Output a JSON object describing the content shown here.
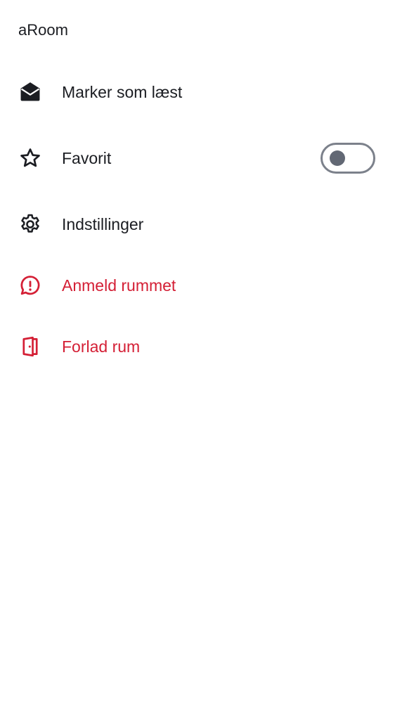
{
  "header": {
    "room_name": "aRoom"
  },
  "menu": {
    "items": [
      {
        "label": "Marker som læst",
        "icon": "mail-open-icon",
        "color": "#1b1d22"
      },
      {
        "label": "Favorit",
        "icon": "star-icon",
        "color": "#1b1d22",
        "toggle_on": false
      },
      {
        "label": "Indstillinger",
        "icon": "gear-icon",
        "color": "#1b1d22"
      },
      {
        "label": "Anmeld rummet",
        "icon": "report-icon",
        "color": "#d41f35"
      },
      {
        "label": "Forlad rum",
        "icon": "leave-door-icon",
        "color": "#d41f35"
      }
    ]
  },
  "colors": {
    "text": "#1b1d22",
    "danger": "#d41f35",
    "toggle_border": "#7c818b",
    "toggle_knob": "#626874",
    "background": "#ffffff"
  }
}
